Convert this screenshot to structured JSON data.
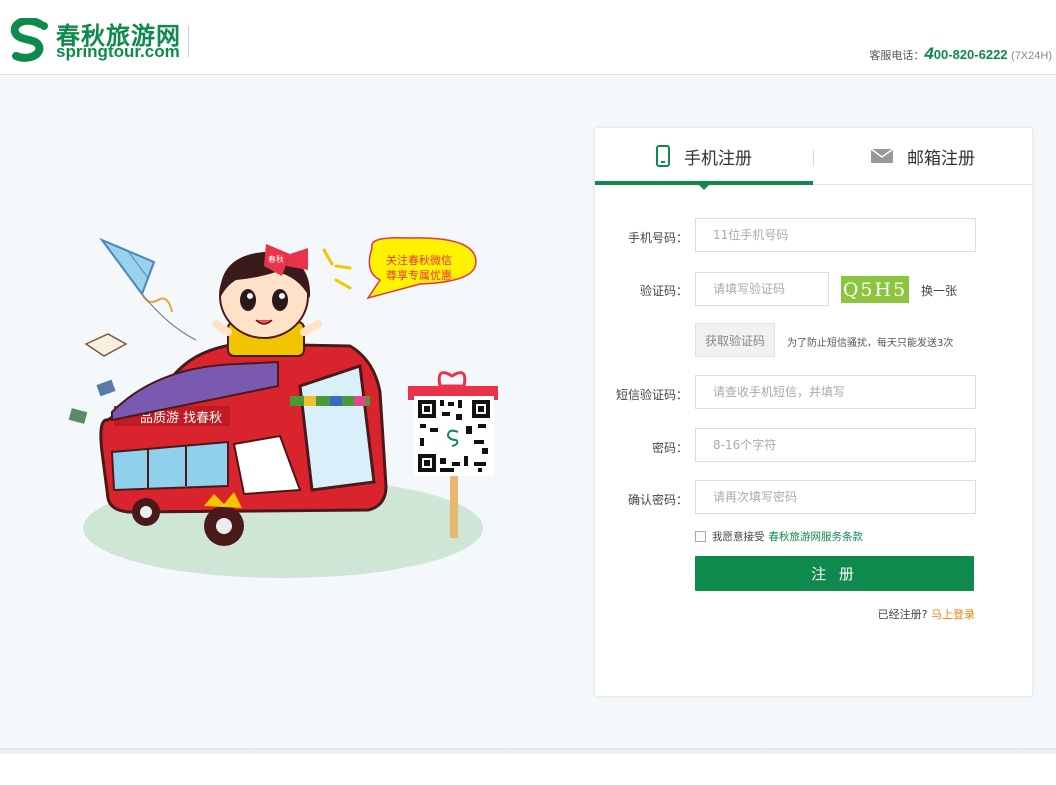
{
  "header": {
    "logo_cn": "春秋旅游网",
    "logo_en": "springtour.com",
    "hotline_label": "客服电话：",
    "hotline_first": "4",
    "hotline_rest": "00-820-6222",
    "hotline_hours": "(7X24H)"
  },
  "illustration": {
    "bubble_line1": "关注春秋微信",
    "bubble_line2": "尊享专属优惠",
    "bus_slogan": "品质游  找春秋",
    "bow_text": "春秋"
  },
  "tabs": {
    "phone": "手机注册",
    "email": "邮箱注册"
  },
  "form": {
    "phone_label": "手机号码：",
    "phone_placeholder": "11位手机号码",
    "code_label": "验证码：",
    "code_placeholder": "请填写验证码",
    "captcha_text": "Q5H5",
    "swap_label": "换一张",
    "sms_button": "获取验证码",
    "sms_tip": "为了防止短信骚扰，每天只能发送3次",
    "sms_code_label": "短信验证码：",
    "sms_code_placeholder": "请查收手机短信，并填写",
    "password_label": "密码：",
    "password_placeholder": "8-16个字符",
    "confirm_label": "确认密码：",
    "confirm_placeholder": "请再次填写密码",
    "agree_text": "我愿意接受",
    "terms_link": "春秋旅游网服务条款",
    "submit_label": "注 册",
    "already_text": "已经注册?",
    "login_link": "马上登录"
  },
  "colors": {
    "brand_green": "#0d8a4c",
    "captcha_bg": "#8cc63f",
    "login_orange": "#f08200"
  }
}
